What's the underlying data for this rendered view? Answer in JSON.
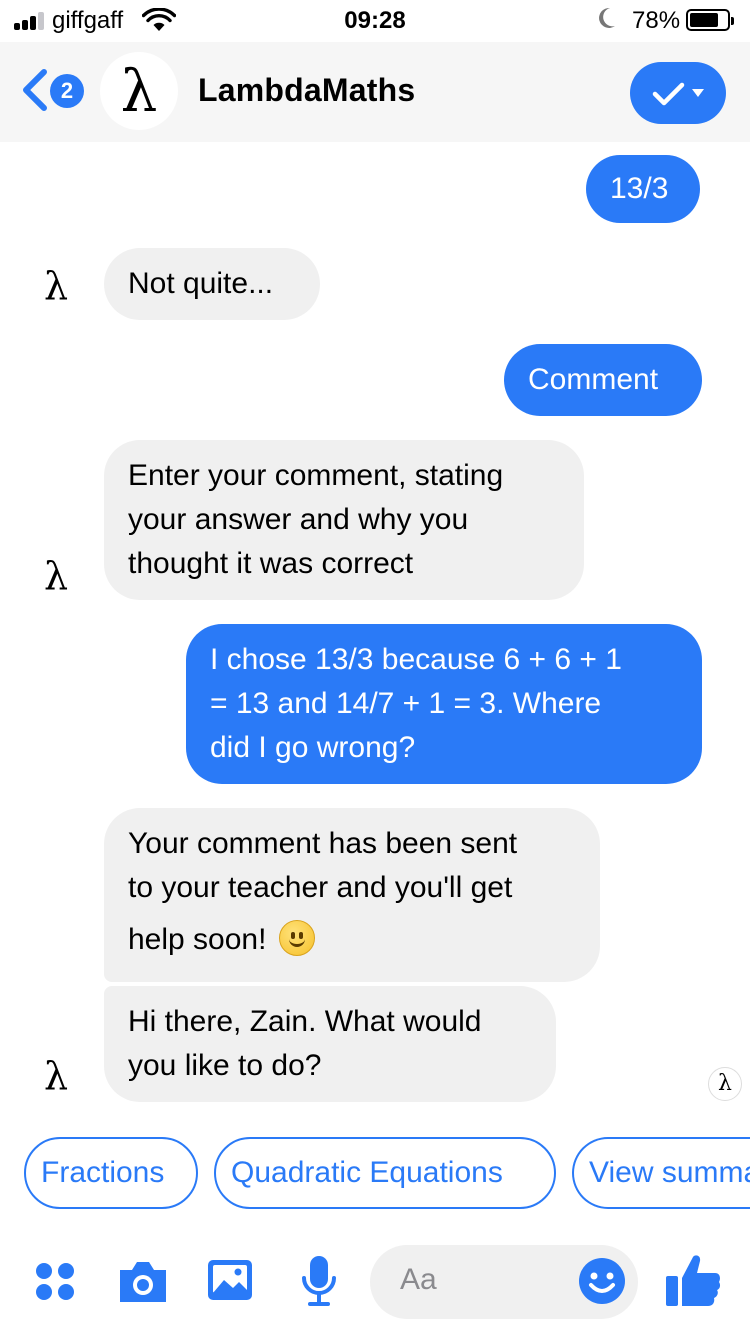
{
  "status_bar": {
    "carrier": "giffgaff",
    "time": "09:28",
    "battery_percent": "78%",
    "battery_level": 0.78
  },
  "header": {
    "unread_count": "2",
    "avatar_glyph": "λ",
    "title": "LambdaMaths"
  },
  "messages": [
    {
      "from": "user",
      "lines": [
        "13/3"
      ]
    },
    {
      "from": "bot",
      "lines": [
        "Not quite..."
      ]
    },
    {
      "from": "user",
      "lines": [
        "Comment"
      ]
    },
    {
      "from": "bot",
      "lines": [
        "Enter your comment, stating",
        "your answer and why you",
        "thought it was correct"
      ]
    },
    {
      "from": "user",
      "lines": [
        "I chose 13/3 because 6 + 6 + 1",
        "= 13 and 14/7 + 1 = 3. Where",
        "did I go wrong?"
      ]
    },
    {
      "from": "bot",
      "lines": [
        "Your comment has been sent",
        "to your teacher and you'll get",
        "help soon!"
      ],
      "emoji": "slightly-smiling-face"
    },
    {
      "from": "bot",
      "lines": [
        "Hi there, Zain. What would",
        "you like to do?"
      ]
    }
  ],
  "bot_avatar_glyph": "λ",
  "quick_replies": [
    "Fractions",
    "Quadratic Equations",
    "View summary"
  ],
  "composer": {
    "placeholder": "Aa",
    "icons": [
      "apps-icon",
      "camera-icon",
      "image-icon",
      "microphone-icon",
      "emoji-icon",
      "thumbs-up-icon"
    ]
  },
  "colors": {
    "accent": "#2a7af7",
    "incoming_bubble": "#f0f0f0",
    "header_bg": "#f6f6f6"
  }
}
